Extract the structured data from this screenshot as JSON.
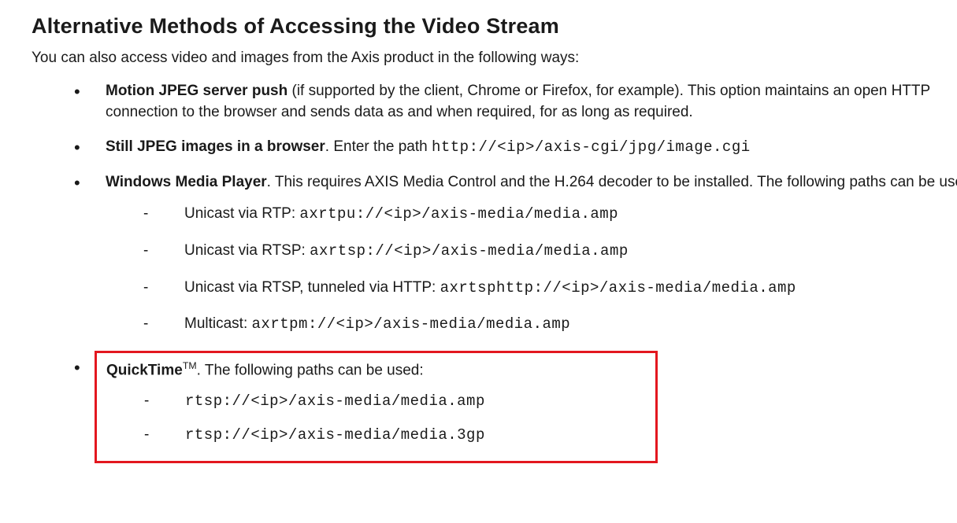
{
  "title": "Alternative Methods of Accessing the Video Stream",
  "intro": "You can also access video and images from the Axis product in the following ways:",
  "items": {
    "mjpeg": {
      "label": "Motion JPEG server push",
      "text": " (if supported by the client, Chrome or Firefox, for example). This option maintains an open HTTP connection to the browser and sends data as and when required, for as long as required."
    },
    "still": {
      "label": "Still JPEG images in a browser",
      "text": ". Enter the path ",
      "code": "http://<ip>/axis-cgi/jpg/image.cgi"
    },
    "wmp": {
      "label": "Windows Media Player",
      "text": ". This requires AXIS Media Control and the H.264 decoder to be installed. The following paths can be used:",
      "sub": {
        "rtp": {
          "label": "Unicast via RTP: ",
          "code": "axrtpu://<ip>/axis-media/media.amp"
        },
        "rtsp": {
          "label": "Unicast via RTSP: ",
          "code": "axrtsp://<ip>/axis-media/media.amp"
        },
        "rtsp_http": {
          "label": "Unicast via RTSP, tunneled via HTTP: ",
          "code": "axrtsphttp://<ip>/axis-media/media.amp"
        },
        "multicast": {
          "label": "Multicast: ",
          "code": "axrtpm://<ip>/axis-media/media.amp"
        }
      }
    },
    "quicktime": {
      "label": "QuickTime",
      "tm": "TM",
      "text": ". The following paths can be used:",
      "sub": {
        "amp": {
          "code": "rtsp://<ip>/axis-media/media.amp"
        },
        "3gp": {
          "code": "rtsp://<ip>/axis-media/media.3gp"
        }
      }
    }
  }
}
